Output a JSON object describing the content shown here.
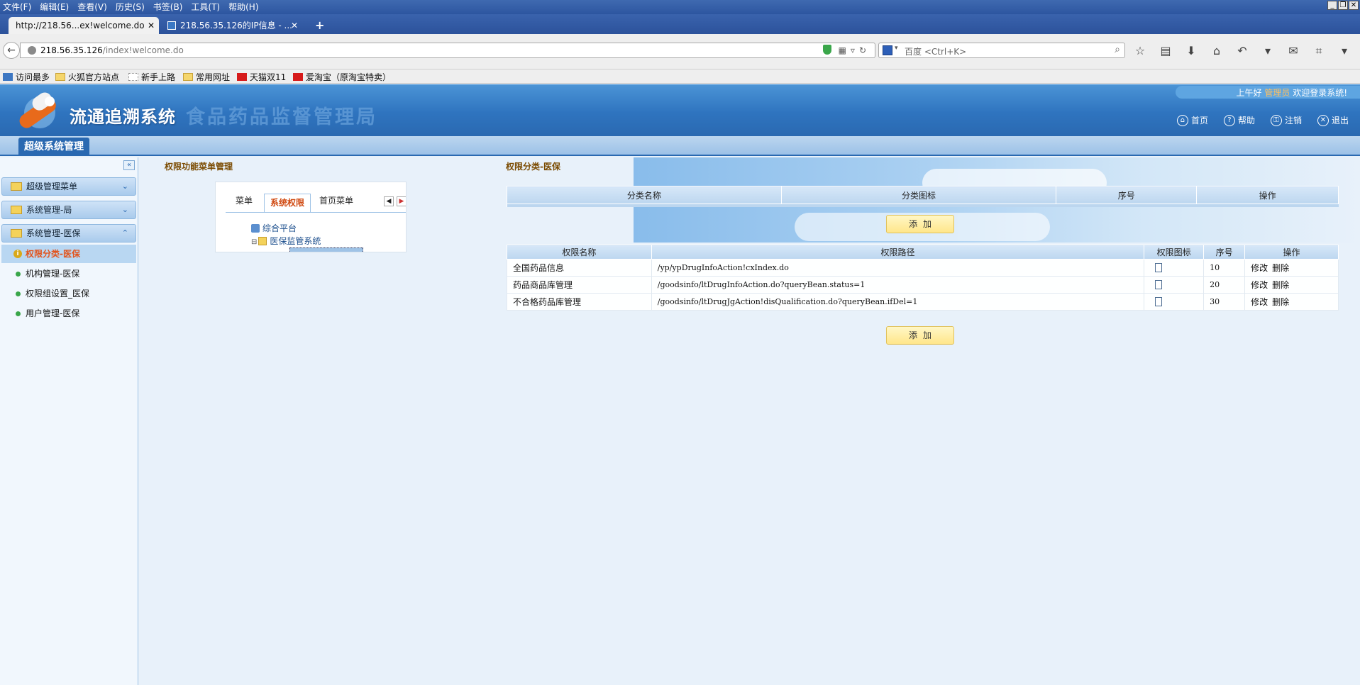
{
  "browser": {
    "menu": [
      "文件(F)",
      "编辑(E)",
      "查看(V)",
      "历史(S)",
      "书签(B)",
      "工具(T)",
      "帮助(H)"
    ],
    "tabs": [
      {
        "title": "http://218.56...ex!welcome.do"
      },
      {
        "title": "218.56.35.126的IP信息 - ..."
      }
    ],
    "new_tab": "+",
    "url_host": "218.56.35.126",
    "url_path": "/index!welcome.do",
    "search_placeholder": "百度 <Ctrl+K>",
    "bookmarks": [
      "访问最多",
      "火狐官方站点",
      "新手上路",
      "常用网址",
      "天猫双11",
      "爱淘宝（原淘宝特卖）"
    ]
  },
  "header": {
    "title": "流通追溯系统",
    "org": "食品药品监督管理局",
    "greeting_prefix": "上午好",
    "user": "管理员",
    "greeting_suffix": "欢迎登录系统!",
    "links": [
      "首页",
      "帮助",
      "注销",
      "退出"
    ],
    "module_tab": "超级系统管理"
  },
  "sidebar": {
    "groups": [
      "超级管理菜单",
      "系统管理-局",
      "系统管理-医保"
    ],
    "items": [
      "权限分类-医保",
      "机构管理-医保",
      "权限组设置_医保",
      "用户管理-医保"
    ]
  },
  "middle": {
    "title": "权限功能菜单管理",
    "tabs": [
      "菜单",
      "系统权限",
      "首页菜单"
    ],
    "tree": [
      "综合平台",
      "医保监管系统"
    ]
  },
  "right": {
    "title": "权限分类-医保",
    "category_table": {
      "headers": [
        "分类名称",
        "分类图标",
        "序号",
        "操作"
      ]
    },
    "add_label": "添加",
    "perm_table": {
      "headers": [
        "权限名称",
        "权限路径",
        "权限图标",
        "序号",
        "操作"
      ],
      "rows": [
        {
          "name": "全国药品信息",
          "path": "/yp/ypDrugInfoAction!cxIndex.do",
          "seq": "10"
        },
        {
          "name": "药品商品库管理",
          "path": "/goodsinfo/ltDrugInfoAction.do?queryBean.status=1",
          "seq": "20"
        },
        {
          "name": "不合格药品库管理",
          "path": "/goodsinfo/ltDrugJgAction!disQualification.do?queryBean.ifDel=1",
          "seq": "30"
        }
      ],
      "edit_label": "修改",
      "delete_label": "删除"
    }
  }
}
